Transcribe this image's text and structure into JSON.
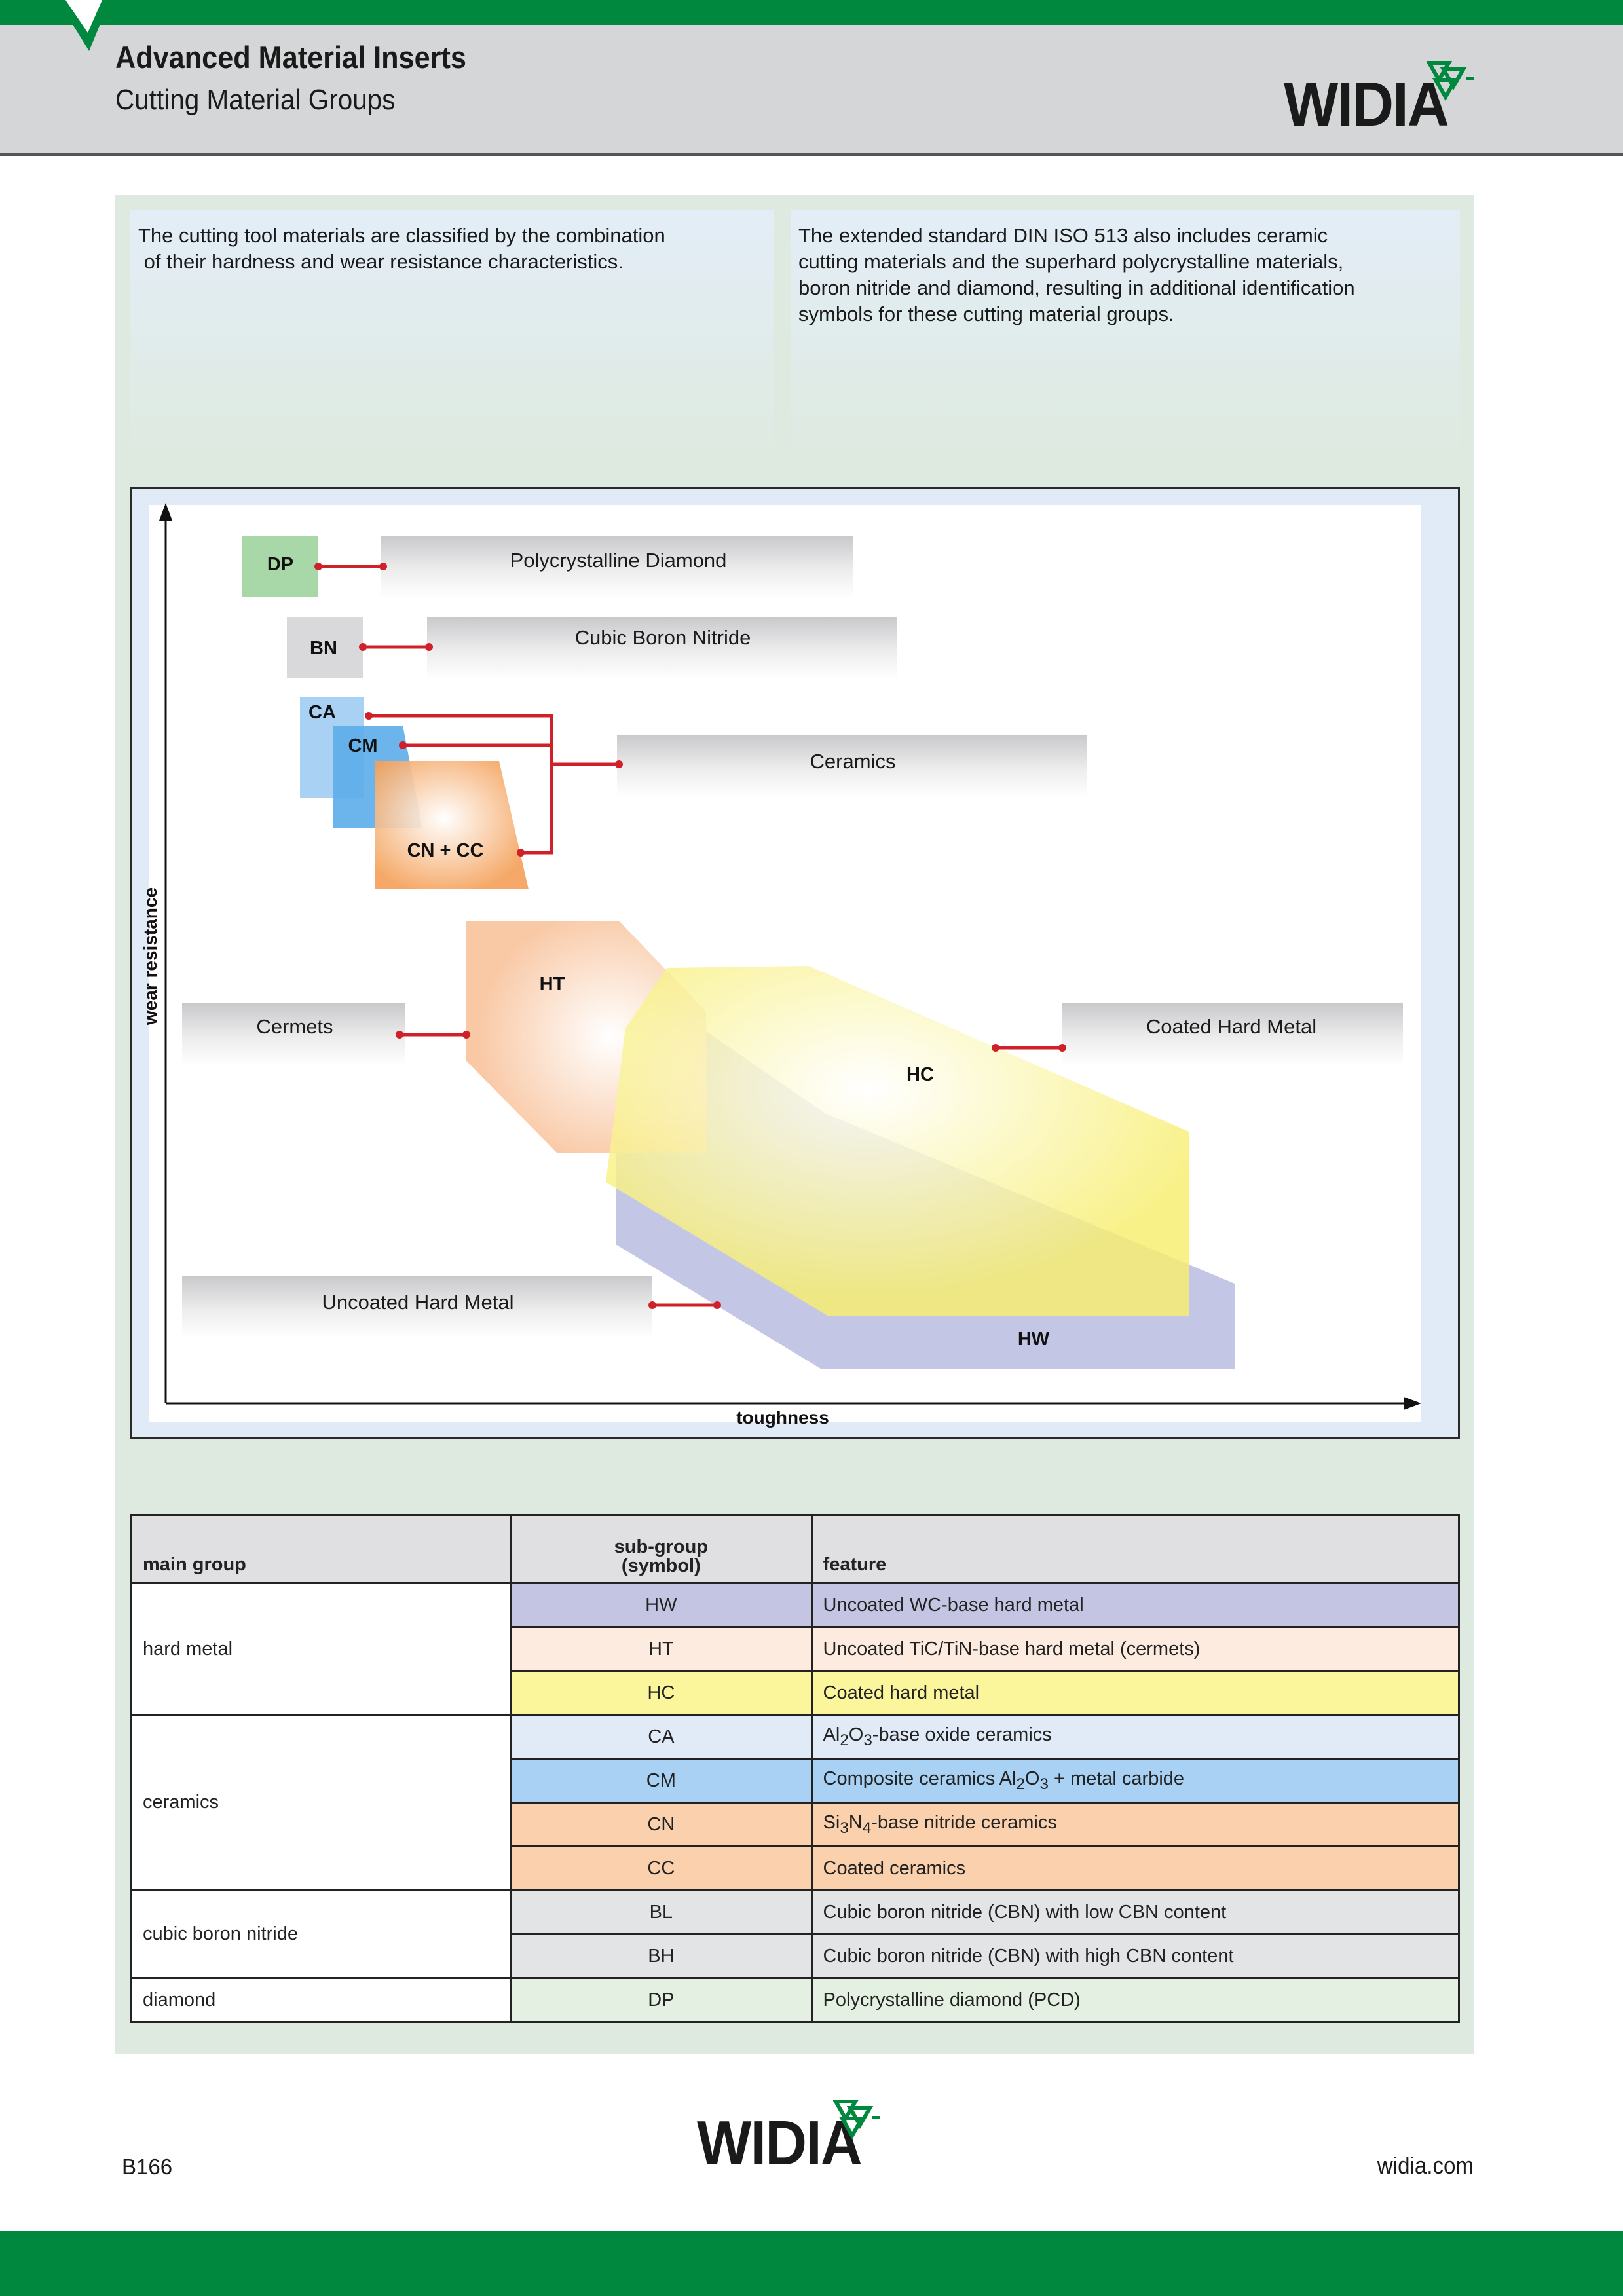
{
  "header": {
    "title": "Advanced Material Inserts",
    "subtitle": "Cutting Material Groups",
    "logo_text": "WIDIA",
    "brand_color": "#00883e"
  },
  "intro": {
    "left": "The cutting tool materials are classified by the combination\n of their hardness and wear resistance characteristics.",
    "right": "The extended standard DIN ISO 513 also includes ceramic\ncutting materials and the superhard polycrystalline materials,\nboron nitride and diamond, resulting in additional identification\nsymbols for these cutting material groups."
  },
  "diagram": {
    "y_axis": "wear resistance",
    "x_axis": "toughness",
    "symbols": {
      "dp": "DP",
      "bn": "BN",
      "ca": "CA",
      "cm": "CM",
      "cncc": "CN + CC",
      "ht": "HT",
      "hc": "HC",
      "hw": "HW"
    },
    "labels": {
      "pcd": "Polycrystalline Diamond",
      "cbn": "Cubic Boron Nitride",
      "ceramics": "Ceramics",
      "cermets": "Cermets",
      "coated": "Coated Hard Metal",
      "uncoated": "Uncoated Hard Metal"
    },
    "colors": {
      "dp": "#a8d7a8",
      "bn": "#d9d9db",
      "ca": "#a9d1f3",
      "cm": "#5cacea",
      "cncc": "#f4a15a",
      "ht": "#f9c9a6",
      "hc": "#f7ee6e",
      "hw": "#b8bcdf",
      "connector": "#d0202a"
    }
  },
  "table": {
    "headers": {
      "main": "main group",
      "sym": "sub-group\n(symbol)",
      "feature": "feature"
    },
    "groups": {
      "hard_metal": "hard metal",
      "ceramics": "ceramics",
      "cbn": "cubic boron nitride",
      "diamond": "diamond"
    },
    "rows": [
      {
        "symbol": "HW",
        "feature": "Uncoated WC-base hard metal",
        "color": "#c3c5e2"
      },
      {
        "symbol": "HT",
        "feature": "Uncoated TiC/TiN-base hard metal (cermets)",
        "color": "#fdebe0"
      },
      {
        "symbol": "HC",
        "feature": "Coated hard metal",
        "color": "#fbf59b"
      },
      {
        "symbol": "CA",
        "feature_pre": "Al",
        "feature_sub1": "2",
        "feature_mid": "O",
        "feature_sub2": "3",
        "feature_post": "-base oxide ceramics",
        "color": "#e1ebf7"
      },
      {
        "symbol": "CM",
        "feature_pre": "Composite ceramics Al",
        "feature_sub1": "2",
        "feature_mid": "O",
        "feature_sub2": "3",
        "feature_post": " + metal carbide",
        "color": "#a9d1f3"
      },
      {
        "symbol": "CN",
        "feature_pre": "Si",
        "feature_sub1": "3",
        "feature_mid": "N",
        "feature_sub2": "4",
        "feature_post": "-base nitride ceramics",
        "color": "#fbd1ad"
      },
      {
        "symbol": "CC",
        "feature": "Coated ceramics",
        "color": "#fbd1ad"
      },
      {
        "symbol": "BL",
        "feature": "Cubic boron nitride (CBN) with low CBN content",
        "color": "#e3e4e6"
      },
      {
        "symbol": "BH",
        "feature": "Cubic boron nitride (CBN) with high CBN content",
        "color": "#e3e4e6"
      },
      {
        "symbol": "DP",
        "feature": "Polycrystalline diamond (PCD)",
        "color": "#e4f0e1"
      }
    ]
  },
  "footer": {
    "page_code": "B166",
    "url": "widia.com",
    "logo_text": "WIDIA"
  }
}
